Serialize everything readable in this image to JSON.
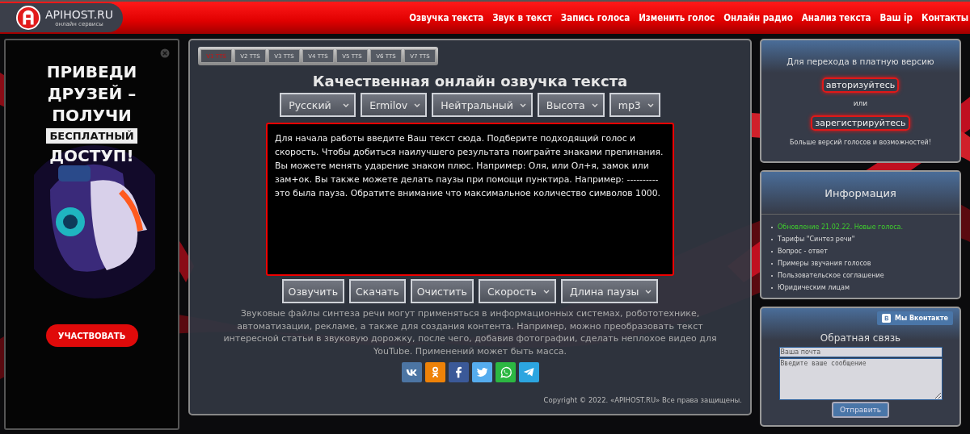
{
  "header": {
    "logo_text": "APIHOST.RU",
    "logo_subtitle": "онлайн сервисы",
    "nav": [
      {
        "label": "Озвучка текста"
      },
      {
        "label": "Звук в текст"
      },
      {
        "label": "Запись голоса"
      },
      {
        "label": "Изменить голос"
      },
      {
        "label": "Онлайн радио"
      },
      {
        "label": "Анализ текста"
      },
      {
        "label": "Ваш ip"
      },
      {
        "label": "Контакты"
      }
    ]
  },
  "ad": {
    "headline": [
      "ПРИВЕДИ",
      "ДРУЗЕЙ –",
      "ПОЛУЧИ"
    ],
    "highlight": "БЕСПЛАТНЫЙ",
    "headline_end": "ДОСТУП!",
    "button": "УЧАСТВОВАТЬ"
  },
  "main": {
    "version_tabs": [
      {
        "label": "V1 TTS",
        "selected": true
      },
      {
        "label": "V2 TTS",
        "selected": false
      },
      {
        "label": "V3 TTS",
        "selected": false
      },
      {
        "label": "V4 TTS",
        "selected": false
      },
      {
        "label": "V5 TTS",
        "selected": false
      },
      {
        "label": "V6 TTS",
        "selected": false
      },
      {
        "label": "V7 TTS",
        "selected": false
      }
    ],
    "title": "Качественная онлайн озвучка текста",
    "selects": [
      "Русский",
      "Ermilov",
      "Нейтральный",
      "Высота",
      "mp3"
    ],
    "text_value": "Для начала работы введите Ваш текст сюда. Подберите подходящий голос и скорость. Чтобы добиться наилучшего результата поиграйте знаками препинания. Вы можете менять ударение знаком плюс. Например: Оля, или Ол+я, замок или зам+ок. Вы также можете делать паузы при помощи пунктира. Например: ---------- это была пауза. Обратите внимание что максимальное количество символов 1000.",
    "actions": [
      {
        "kind": "button",
        "label": "Озвучить"
      },
      {
        "kind": "button",
        "label": "Скачать"
      },
      {
        "kind": "button",
        "label": "Очистить"
      },
      {
        "kind": "select",
        "label": "Скорость"
      },
      {
        "kind": "select",
        "label": "Длина паузы"
      }
    ],
    "description": "Звуковые файлы синтеза речи могут применяться в информационных системах, робототехнике, автоматизации, рекламе, а также для создания контента. Например, можно преобразовать текст интересной статьи в звуковую дорожку, после чего, добавив фотографии, сделать неплохое видео для YouTube. Применений может быть масса.",
    "share": [
      {
        "kind": "vk",
        "color": "#4c75a3"
      },
      {
        "kind": "ok",
        "color": "#ee8208"
      },
      {
        "kind": "facebook",
        "color": "#3b5998"
      },
      {
        "kind": "twitter",
        "color": "#55acee"
      },
      {
        "kind": "whatsapp",
        "color": "#2cb742"
      },
      {
        "kind": "telegram",
        "color": "#2ca5e0"
      }
    ],
    "copyright": "Copyright © 2022. «APIHOST.RU» Все права защищены."
  },
  "premium": {
    "text": "Для перехода в платную версию",
    "login": "авторизуйтесь",
    "or": "или",
    "register": "зарегистрируйтесь",
    "note": "Больше версий голосов и возможностей!"
  },
  "info": {
    "title": "Информация",
    "items": [
      {
        "label": "Обновление 21.02.22. Новые голоса.",
        "highlight": true
      },
      {
        "label": "Тарифы \"Синтез речи\"",
        "highlight": false
      },
      {
        "label": "Вопрос - ответ",
        "highlight": false
      },
      {
        "label": "Примеры звучания голосов",
        "highlight": false
      },
      {
        "label": "Пользовательское соглашение",
        "highlight": false
      },
      {
        "label": "Юридическим лицам",
        "highlight": false
      }
    ]
  },
  "feedback": {
    "vk_button": "Мы Вконтакте",
    "title": "Обратная связь",
    "email_placeholder": "Ваша почта",
    "message_placeholder": "Введите ваше сообщение",
    "submit": "Отправить"
  }
}
